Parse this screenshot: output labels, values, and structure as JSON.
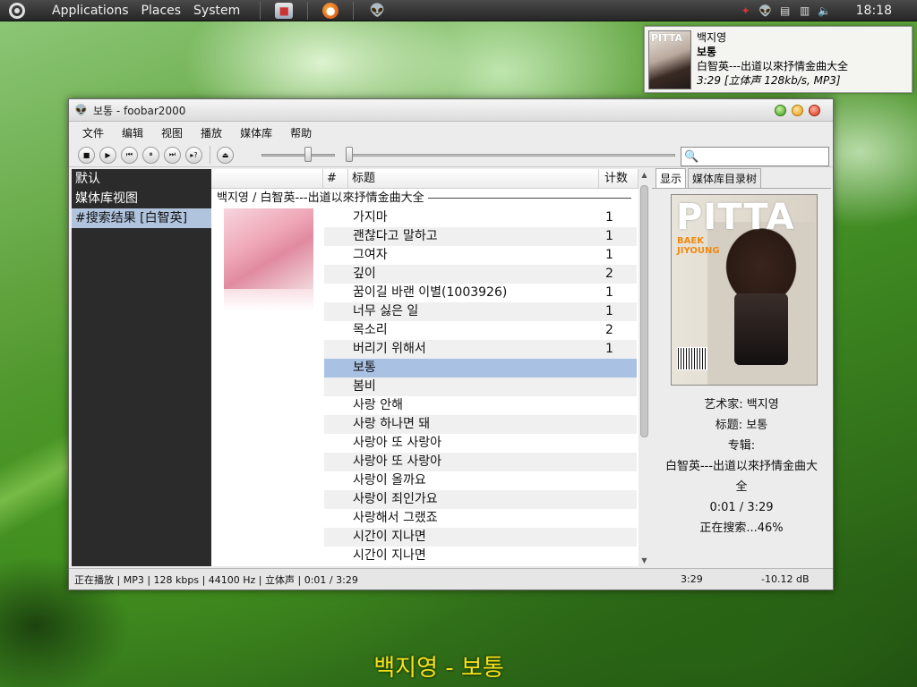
{
  "panel": {
    "menus": [
      "Applications",
      "Places",
      "System"
    ],
    "clock": "18:18"
  },
  "notification": {
    "cover_text": "PITTA",
    "artist": "백지영",
    "title": "보통",
    "album": "白智英---出道以來抒情金曲大全",
    "info": "3:29 [立体声 128kb/s, MP3]"
  },
  "window": {
    "title": "보통 - foobar2000",
    "menus": [
      "文件",
      "编辑",
      "视图",
      "播放",
      "媒体库",
      "帮助"
    ],
    "search_placeholder": ""
  },
  "sidebar": {
    "items": [
      "默认",
      "媒体库视图",
      "#搜索结果 [白智英]"
    ],
    "active_index": 2
  },
  "playlist": {
    "headers": {
      "blank": "",
      "num": "#",
      "title": "标题",
      "count": "计数"
    },
    "group": "백지영 / 白智英---出道以來抒情金曲大全",
    "rows": [
      {
        "title": "가지마",
        "count": "1"
      },
      {
        "title": "괜찮다고 말하고",
        "count": "1"
      },
      {
        "title": "그여자",
        "count": "1"
      },
      {
        "title": "깊이",
        "count": "2"
      },
      {
        "title": "꿈이길 바랜 이별(1003926)",
        "count": "1"
      },
      {
        "title": "너무 싫은 일",
        "count": "1"
      },
      {
        "title": "목소리",
        "count": "2"
      },
      {
        "title": "버리기 위해서",
        "count": "1"
      },
      {
        "title": "보통",
        "count": ""
      },
      {
        "title": "봄비",
        "count": ""
      },
      {
        "title": "사랑 안해",
        "count": ""
      },
      {
        "title": "사랑 하나면 돼",
        "count": ""
      },
      {
        "title": "사랑아 또 사랑아",
        "count": ""
      },
      {
        "title": "사랑아 또 사랑아",
        "count": ""
      },
      {
        "title": "사랑이 올까요",
        "count": ""
      },
      {
        "title": "사랑이 죄인가요",
        "count": ""
      },
      {
        "title": "사랑해서 그랬죠",
        "count": ""
      },
      {
        "title": "시간이 지나면",
        "count": ""
      },
      {
        "title": "시간이 지나면",
        "count": ""
      }
    ],
    "selected_index": 8
  },
  "right_panel": {
    "tabs": [
      "显示",
      "媒体库目录树"
    ],
    "cover_title": "PITTA",
    "cover_sub1": "BAEK",
    "cover_sub2": "JIYOUNG",
    "artist_line": "艺术家: 백지영",
    "title_line": "标题: 보통",
    "album_label": "专辑:",
    "album_line1": "白智英---出道以來抒情金曲大",
    "album_line2": "全",
    "time_line": "0:01 / 3:29",
    "search_status": "正在搜索...46%"
  },
  "statusbar": {
    "left": "正在播放 | MP3 | 128 kbps | 44100 Hz | 立体声 | 0:01 / 3:29",
    "time": "3:29",
    "db": "-10.12 dB"
  },
  "osd": {
    "text": "백지영 - 보통"
  },
  "colors": {
    "selected_row": "#a9c2e4",
    "sidebar_bg": "#2b2b2b",
    "osd_text": "#f7e21a"
  }
}
